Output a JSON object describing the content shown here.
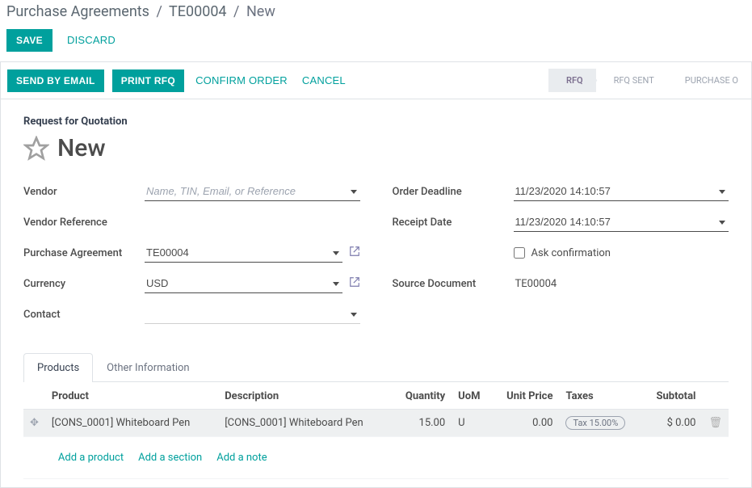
{
  "breadcrumb": {
    "root": "Purchase Agreements",
    "mid": "TE00004",
    "current": "New"
  },
  "toolbar": {
    "save": "SAVE",
    "discard": "DISCARD"
  },
  "statusbar": {
    "send_email": "SEND BY EMAIL",
    "print_rfq": "PRINT RFQ",
    "confirm": "CONFIRM ORDER",
    "cancel": "CANCEL",
    "stages": {
      "rfq": "RFQ",
      "rfq_sent": "RFQ SENT",
      "po": "PURCHASE O"
    }
  },
  "header": {
    "section": "Request for Quotation",
    "title": "New"
  },
  "fields": {
    "vendor_label": "Vendor",
    "vendor_placeholder": "Name, TIN, Email, or Reference",
    "vendor_ref_label": "Vendor Reference",
    "pa_label": "Purchase Agreement",
    "pa_value": "TE00004",
    "currency_label": "Currency",
    "currency_value": "USD",
    "contact_label": "Contact",
    "deadline_label": "Order Deadline",
    "deadline_value": "11/23/2020 14:10:57",
    "receipt_label": "Receipt Date",
    "receipt_value": "11/23/2020 14:10:57",
    "ask_conf": "Ask confirmation",
    "source_label": "Source Document",
    "source_value": "TE00004"
  },
  "tabs": {
    "products": "Products",
    "other": "Other Information"
  },
  "table": {
    "headers": {
      "product": "Product",
      "desc": "Description",
      "qty": "Quantity",
      "uom": "UoM",
      "price": "Unit Price",
      "taxes": "Taxes",
      "subtotal": "Subtotal"
    },
    "rows": [
      {
        "product": "[CONS_0001] Whiteboard Pen",
        "desc": "[CONS_0001] Whiteboard Pen",
        "qty": "15.00",
        "uom": "U",
        "price": "0.00",
        "tax": "Tax 15.00%",
        "subtotal": "$ 0.00"
      }
    ],
    "add_product": "Add a product",
    "add_section": "Add a section",
    "add_note": "Add a note"
  }
}
